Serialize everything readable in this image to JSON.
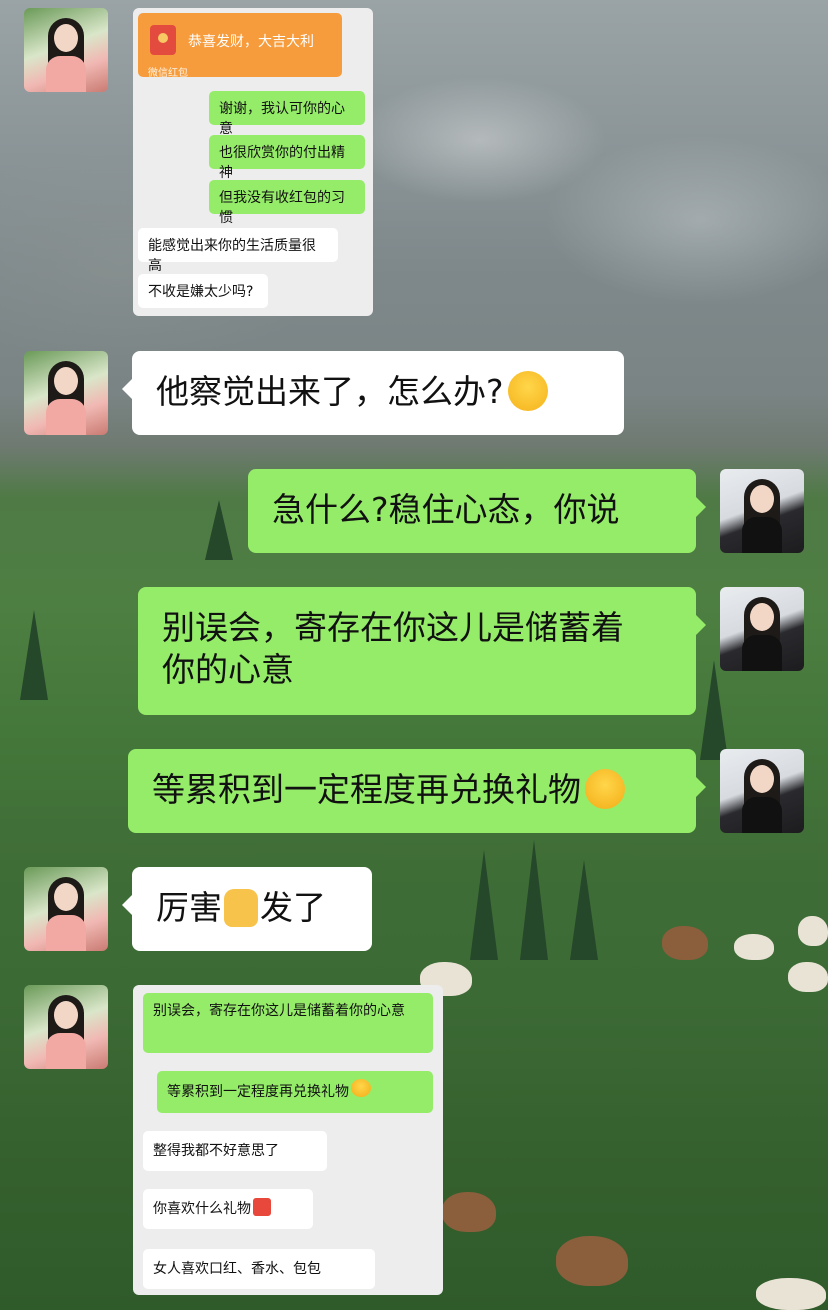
{
  "chat": {
    "screenshot1": {
      "red_packet": {
        "title": "恭喜发财，大吉大利",
        "footer": "微信红包"
      },
      "messages": [
        "谢谢，我认可你的心意",
        "也很欣赏你的付出精神",
        "但我没有收红包的习惯",
        "能感觉出来你的生活质量很高",
        "不收是嫌太少吗?"
      ]
    },
    "msg1": {
      "text": "他察觉出来了，怎么办?",
      "emoji": "crying-laughing-emoji"
    },
    "msg2": {
      "text": "急什么?稳住心态，你说"
    },
    "msg3": {
      "line1": "别误会，寄存在你这儿是储蓄着",
      "line2": "你的心意"
    },
    "msg4": {
      "text": "等累积到一定程度再兑换礼物",
      "emoji": "thinking-emoji"
    },
    "msg5": {
      "before": "厉害",
      "emoji": "thumbs-up-emoji",
      "after": "发了"
    },
    "screenshot2": {
      "messages": [
        "别误会，寄存在你这儿是储蓄着你的心意",
        "等累积到一定程度再兑换礼物",
        "整得我都不好意思了",
        "你喜欢什么礼物",
        "女人喜欢口红、香水、包包"
      ]
    }
  },
  "colors": {
    "green_bubble": "#95ec69",
    "white_bubble": "#ffffff",
    "red_packet": "#f79c3c"
  }
}
